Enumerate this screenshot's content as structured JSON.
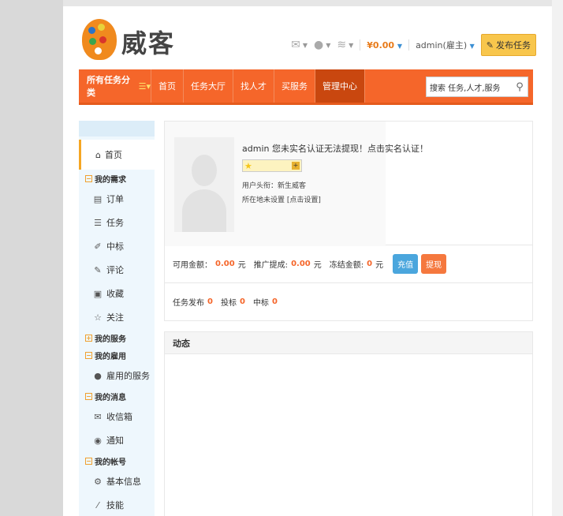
{
  "brand": {
    "logo_text": "威客"
  },
  "header": {
    "money": "¥0.00",
    "user": "admin(雇主)",
    "post_task": "发布任务"
  },
  "nav": {
    "category": "所有任务分类",
    "items": [
      "首页",
      "任务大厅",
      "找人才",
      "买服务",
      "管理中心"
    ],
    "active_index": 4,
    "search_placeholder": "搜索 任务,人才,服务"
  },
  "sidebar": {
    "home": "首页",
    "groups": [
      {
        "title": "我的需求",
        "items": [
          {
            "label": "订单",
            "icon": "order-icon"
          },
          {
            "label": "任务",
            "icon": "list-icon"
          },
          {
            "label": "中标",
            "icon": "bid-icon"
          },
          {
            "label": "评论",
            "icon": "comment-icon"
          },
          {
            "label": "收藏",
            "icon": "favorite-icon"
          },
          {
            "label": "关注",
            "icon": "star-icon"
          }
        ]
      },
      {
        "title": "我的服务",
        "items": []
      },
      {
        "title": "我的雇用",
        "items": [
          {
            "label": "雇用的服务",
            "icon": "user-icon"
          }
        ]
      },
      {
        "title": "我的消息",
        "items": [
          {
            "label": "收信箱",
            "icon": "mail-icon"
          },
          {
            "label": "通知",
            "icon": "notice-icon"
          }
        ]
      },
      {
        "title": "我的帐号",
        "items": [
          {
            "label": "基本信息",
            "icon": "gear-icon"
          },
          {
            "label": "技能",
            "icon": "skill-icon"
          }
        ]
      }
    ]
  },
  "profile": {
    "title": "admin 您未实名认证无法提现！点击实名认证！",
    "user_title": "用户头衔：新生威客",
    "location": "所在地未设置 [点击设置]"
  },
  "money": {
    "available_label": "可用金额：",
    "available_value": "0.00",
    "unit": "元",
    "promo_label": "推广提成:",
    "promo_value": "0.00",
    "frozen_label": "冻结金额:",
    "frozen_value": "0",
    "recharge": "充值",
    "withdraw": "提现"
  },
  "stats": {
    "task_label": "任务发布",
    "task_value": "0",
    "bid_label": "投标",
    "bid_value": "0",
    "win_label": "中标",
    "win_value": "0"
  },
  "dynamic": {
    "title": "动态"
  }
}
